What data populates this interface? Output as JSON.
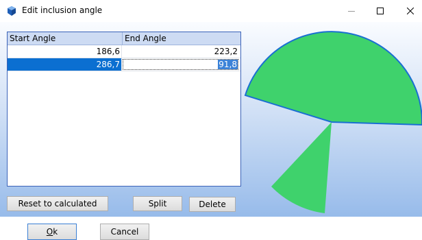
{
  "window": {
    "title": "Edit inclusion angle",
    "minimize_icon": "minimize-icon",
    "maximize_icon": "maximize-icon",
    "close_icon": "close-icon"
  },
  "table": {
    "headers": [
      "Start Angle",
      "End Angle"
    ],
    "rows": [
      {
        "start": "186,6",
        "end": "223,2",
        "selected": false
      },
      {
        "start": "286,7",
        "end": "91,8",
        "selected": true
      }
    ]
  },
  "buttons": {
    "reset": "Reset to calculated",
    "split": "Split",
    "delete": "Delete",
    "ok_letter": "O",
    "ok_rest": "k",
    "cancel": "Cancel"
  },
  "colors": {
    "sector_fill": "#3fd26c",
    "sector_stroke": "#1a6fd2",
    "selection": "#0b6fd1"
  }
}
